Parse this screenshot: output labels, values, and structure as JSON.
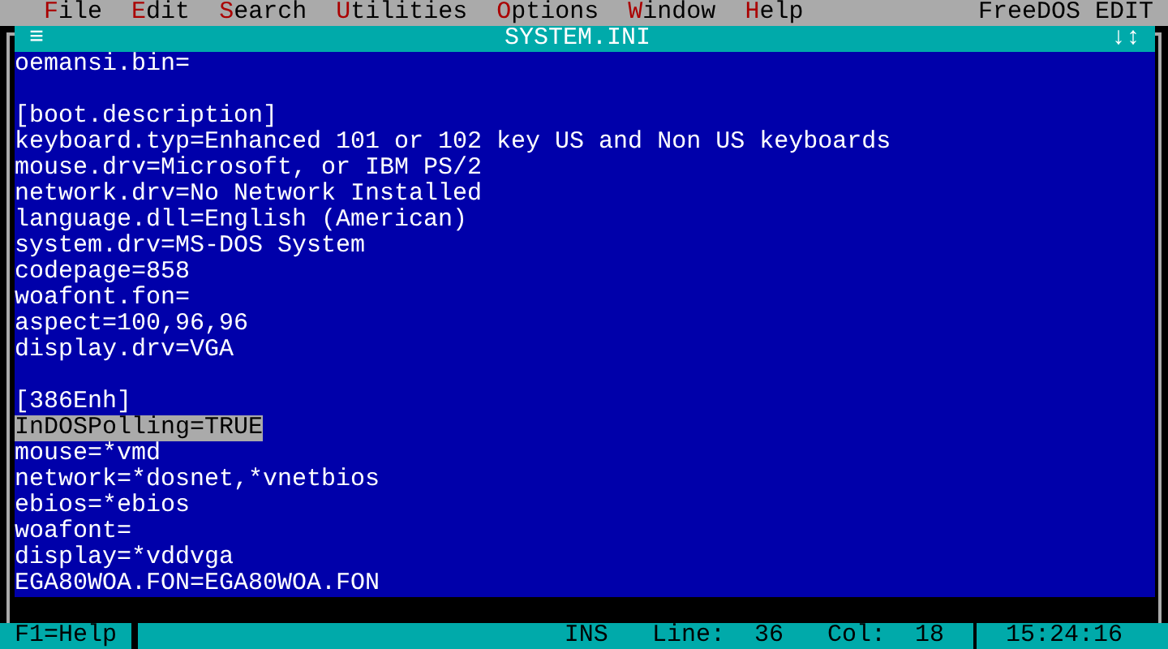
{
  "menu_bar": {
    "items": [
      {
        "hotkey": "F",
        "rest": "ile"
      },
      {
        "hotkey": "E",
        "rest": "dit"
      },
      {
        "hotkey": "S",
        "rest": "earch"
      },
      {
        "hotkey": "U",
        "rest": "tilities"
      },
      {
        "hotkey": "O",
        "rest": "ptions"
      },
      {
        "hotkey": "W",
        "rest": "indow"
      },
      {
        "hotkey": "H",
        "rest": "elp"
      }
    ],
    "app_name": "FreeDOS EDIT"
  },
  "window": {
    "menu_glyph": "≡",
    "title": "SYSTEM.INI",
    "scroll_glyph": "↓↕"
  },
  "lines": [
    {
      "kind": "text",
      "text": "oemansi.bin=",
      "selected": false
    },
    {
      "kind": "blank"
    },
    {
      "kind": "text",
      "text": "[boot.description]",
      "selected": false
    },
    {
      "kind": "text",
      "text": "keyboard.typ=Enhanced 101 or 102 key US and Non US keyboards",
      "selected": false
    },
    {
      "kind": "text",
      "text": "mouse.drv=Microsoft, or IBM PS/2",
      "selected": false
    },
    {
      "kind": "text",
      "text": "network.drv=No Network Installed",
      "selected": false
    },
    {
      "kind": "text",
      "text": "language.dll=English (American)",
      "selected": false
    },
    {
      "kind": "text",
      "text": "system.drv=MS-DOS System",
      "selected": false
    },
    {
      "kind": "text",
      "text": "codepage=858",
      "selected": false
    },
    {
      "kind": "text",
      "text": "woafont.fon=",
      "selected": false
    },
    {
      "kind": "text",
      "text": "aspect=100,96,96",
      "selected": false
    },
    {
      "kind": "text",
      "text": "display.drv=VGA",
      "selected": false
    },
    {
      "kind": "blank"
    },
    {
      "kind": "text",
      "text": "[386Enh]",
      "selected": false
    },
    {
      "kind": "text",
      "text": "InDOSPolling=TRUE",
      "selected": true
    },
    {
      "kind": "text",
      "text": "mouse=*vmd",
      "selected": false
    },
    {
      "kind": "text",
      "text": "network=*dosnet,*vnetbios",
      "selected": false
    },
    {
      "kind": "text",
      "text": "ebios=*ebios",
      "selected": false
    },
    {
      "kind": "text",
      "text": "woafont=",
      "selected": false
    },
    {
      "kind": "text",
      "text": "display=*vddvga",
      "selected": false
    },
    {
      "kind": "text",
      "text": "EGA80WOA.FON=EGA80WOA.FON",
      "selected": false
    }
  ],
  "status_bar": {
    "help": "F1=Help",
    "mode": "INS",
    "line_label": "Line:",
    "line": "36",
    "col_label": "Col:",
    "col": "18",
    "time": "15:24:16"
  }
}
